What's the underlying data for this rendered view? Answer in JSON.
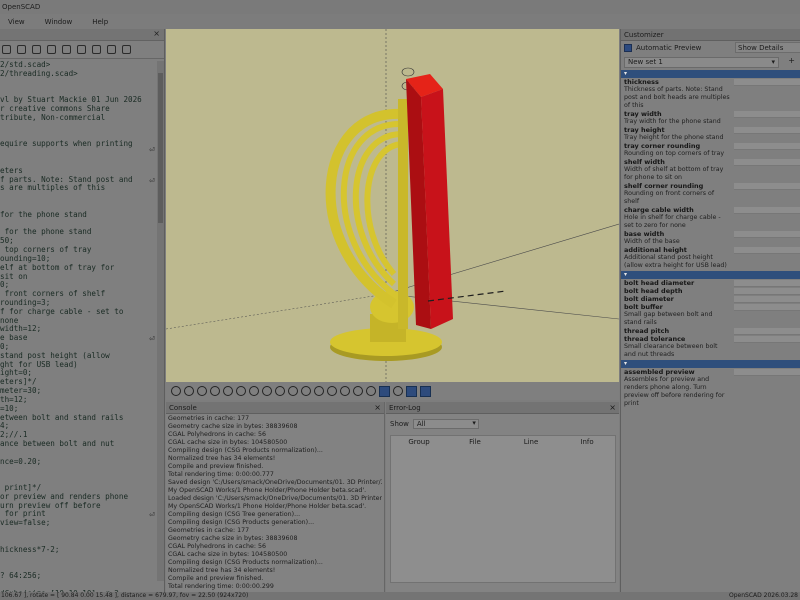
{
  "app": {
    "title": "OpenSCAD"
  },
  "menu": [
    "View",
    "Window",
    "Help"
  ],
  "editor": {
    "lines": [
      "2/std.scad>",
      "2/threading.scad>",
      "",
      "",
      "vl by Stuart Mackie 01 Jun 2026",
      "r creative commons Share",
      "tribute, Non-commercial",
      "",
      "",
      "equire supports when printing",
      "",
      "",
      "eters",
      "f parts. Note: Stand post and",
      "s are multiples of this",
      "",
      "",
      "for the phone stand",
      "",
      " for the phone stand",
      "50;",
      " top corners of tray",
      "ounding=10;",
      "elf at bottom of tray for",
      "sit on",
      "0;",
      " front corners of shelf",
      "rounding=3;",
      "f for charge cable - set to",
      "none",
      "width=12;",
      "e base",
      "0;",
      "stand post height (allow",
      "ght for USB lead)",
      "ight=0;",
      "eters]*/",
      "meter=30;",
      "th=12;",
      "=10;",
      "etween bolt and stand rails",
      "4;",
      "2;//.1",
      "ance between bolt and nut",
      "",
      "nce=0.20;",
      "",
      "",
      " print]*/",
      "or preview and renders phone",
      "urn preview off before",
      " for print",
      "view=false;",
      "",
      "",
      "hickness*7-2;",
      "",
      "",
      "? 64:256;",
      "",
      "dCube(size=[10,10,10], r=2,"
    ]
  },
  "viewport": {
    "colors": {
      "background": "#bdb98f",
      "model": "#d6c52f",
      "phone": "#c8121a"
    }
  },
  "console": {
    "title": "Console",
    "lines": [
      "Geometries in cache: 177",
      "Geometry cache size in bytes: 38839608",
      "CGAL Polyhedrons in cache: 56",
      "CGAL cache size in bytes: 104580500",
      "Compiling design (CSG Products normalization)...",
      "Normalized tree has 34 elements!",
      "Compile and preview finished.",
      "Total rendering time: 0:00:00.777",
      "Saved design 'C:/Users/smack/OneDrive/Documents/01. 3D Printer/3D Files/1",
      "My OpenSCAD Works/1 Phone Holder/Phone Holder beta.scad'.",
      "Loaded design 'C:/Users/smack/OneDrive/Documents/01. 3D Printer/3D Files/1",
      "My OpenSCAD Works/1 Phone Holder/Phone Holder beta.scad'.",
      "Compiling design (CSG Tree generation)...",
      "Compiling design (CSG Products generation)...",
      "Geometries in cache: 177",
      "Geometry cache size in bytes: 38839608",
      "CGAL Polyhedrons in cache: 56",
      "CGAL cache size in bytes: 104580500",
      "Compiling design (CSG Products normalization)...",
      "Normalized tree has 34 elements!",
      "Compile and preview finished.",
      "Total rendering time: 0:00:00.299"
    ]
  },
  "errorlog": {
    "title": "Error-Log",
    "show_label": "Show",
    "show_value": "All",
    "columns": [
      "Group",
      "File",
      "Line",
      "Info"
    ]
  },
  "customizer": {
    "title": "Customizer",
    "auto_preview": "Automatic Preview",
    "show_details": "Show Details",
    "preset": "New set 1",
    "preset_add": "+",
    "sections": [
      {
        "params": [
          {
            "name": "thickness",
            "desc": "Thickness of parts. Note: Stand post and bolt heads are multiples of this"
          },
          {
            "name": "tray width",
            "desc": "Tray width for the phone stand"
          },
          {
            "name": "tray height",
            "desc": "Tray height for the phone stand"
          },
          {
            "name": "tray corner rounding",
            "desc": "Rounding on top corners of tray"
          },
          {
            "name": "shelf width",
            "desc": "Width of shelf at bottom of tray for phone to sit on"
          },
          {
            "name": "shelf corner rounding",
            "desc": "Rounding on front corners of shelf"
          },
          {
            "name": "charge cable width",
            "desc": "Hole in shelf for charge cable - set to zero for none"
          },
          {
            "name": "base width",
            "desc": "Width of the base"
          },
          {
            "name": "additional height",
            "desc": "Additional stand post height (allow extra height for USB lead)"
          }
        ]
      },
      {
        "params": [
          {
            "name": "bolt head diameter",
            "desc": ""
          },
          {
            "name": "bolt head depth",
            "desc": ""
          },
          {
            "name": "bolt diameter",
            "desc": ""
          },
          {
            "name": "bolt buffer",
            "desc": "Small gap between bolt and stand rails"
          },
          {
            "name": "thread pitch",
            "desc": ""
          },
          {
            "name": "thread tolerance",
            "desc": "Small clearance between bolt and nut threads"
          }
        ]
      },
      {
        "params": [
          {
            "name": "assembled preview",
            "desc": "Assembles for preview and renders phone along. Turn preview off before rendering for print"
          }
        ]
      }
    ]
  },
  "status": {
    "left": "106.67 ], rotate = [ 90.84 0.00 15.48 ], distance = 679.97, fov = 22.50 (924x720)",
    "right": "OpenSCAD 2026.03.28"
  }
}
